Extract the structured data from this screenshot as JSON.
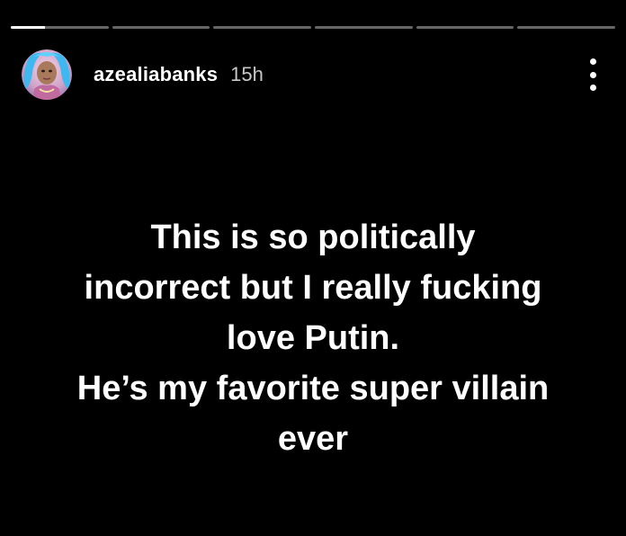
{
  "story": {
    "segment_count": 6,
    "progress": [
      0.35,
      0,
      0,
      0,
      0,
      0
    ],
    "username": "azealiabanks",
    "timestamp": "15h",
    "text_lines": [
      "This is so politically",
      "incorrect but I really fucking",
      "love Putin.",
      "He’s my favorite super villain",
      "ever"
    ]
  },
  "icons": {
    "menu": "more-vertical-icon"
  },
  "colors": {
    "background": "#000000",
    "text": "#ffffff",
    "timestamp": "#c8c8c8",
    "progress_track": "rgba(255,255,255,0.4)"
  }
}
